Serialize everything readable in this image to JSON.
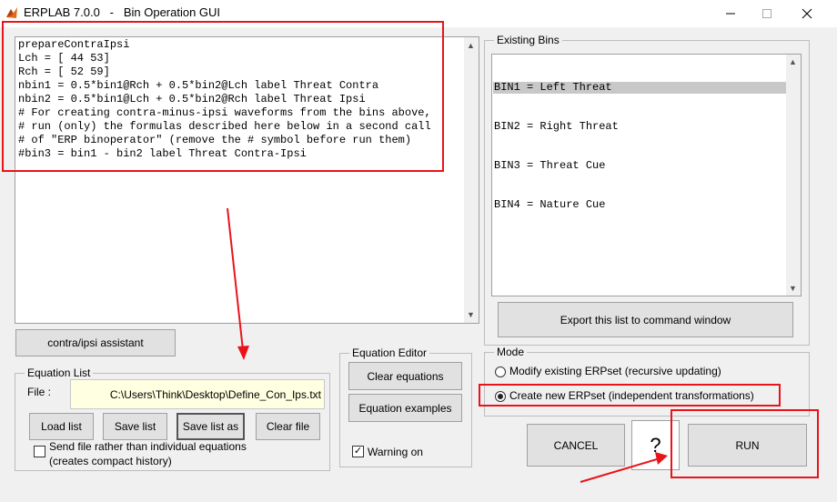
{
  "window": {
    "title": "ERPLAB 7.0.0   -   Bin Operation GUI"
  },
  "editor": {
    "lines": [
      "prepareContraIpsi",
      "Lch = [ 44 53]",
      "Rch = [ 52 59]",
      "nbin1 = 0.5*bin1@Rch + 0.5*bin2@Lch label Threat Contra",
      "nbin2 = 0.5*bin1@Lch + 0.5*bin2@Rch label Threat Ipsi",
      "# For creating contra-minus-ipsi waveforms from the bins above,",
      "# run (only) the formulas described here below in a second call",
      "# of \"ERP binoperator\" (remove the # symbol before run them)",
      "#bin3 = bin1 - bin2 label Threat Contra-Ipsi"
    ]
  },
  "existing_bins": {
    "title": "Existing Bins",
    "items": [
      "BIN1 = Left Threat",
      "BIN2 = Right Threat",
      "BIN3 = Threat Cue",
      "BIN4 = Nature Cue"
    ],
    "export_label": "Export this list to command window"
  },
  "assistant": {
    "label": "contra/ipsi assistant"
  },
  "equation_list": {
    "title": "Equation List",
    "file_label": "File :",
    "file_value": "C:\\Users\\Think\\Desktop\\Define_Con_Ips.txt",
    "load_label": "Load list",
    "save_label": "Save list",
    "save_as_label": "Save list as",
    "clear_file_label": "Clear file",
    "send_file_label_1": "Send file rather than individual equations",
    "send_file_label_2": "(creates compact history)"
  },
  "equation_editor": {
    "title": "Equation Editor",
    "clear_label": "Clear equations",
    "examples_label": "Equation examples",
    "warning_label": "Warning on",
    "warning_checked": "✓"
  },
  "mode": {
    "title": "Mode",
    "option1": "Modify existing ERPset (recursive updating)",
    "option2": "Create new ERPset (independent transformations)"
  },
  "actions": {
    "cancel_label": "CANCEL",
    "help_label": "?",
    "run_label": "RUN"
  },
  "colors": {
    "annotation": "#e8141a",
    "selection": "#c8c8c8",
    "file_bg": "#ffffe1"
  }
}
